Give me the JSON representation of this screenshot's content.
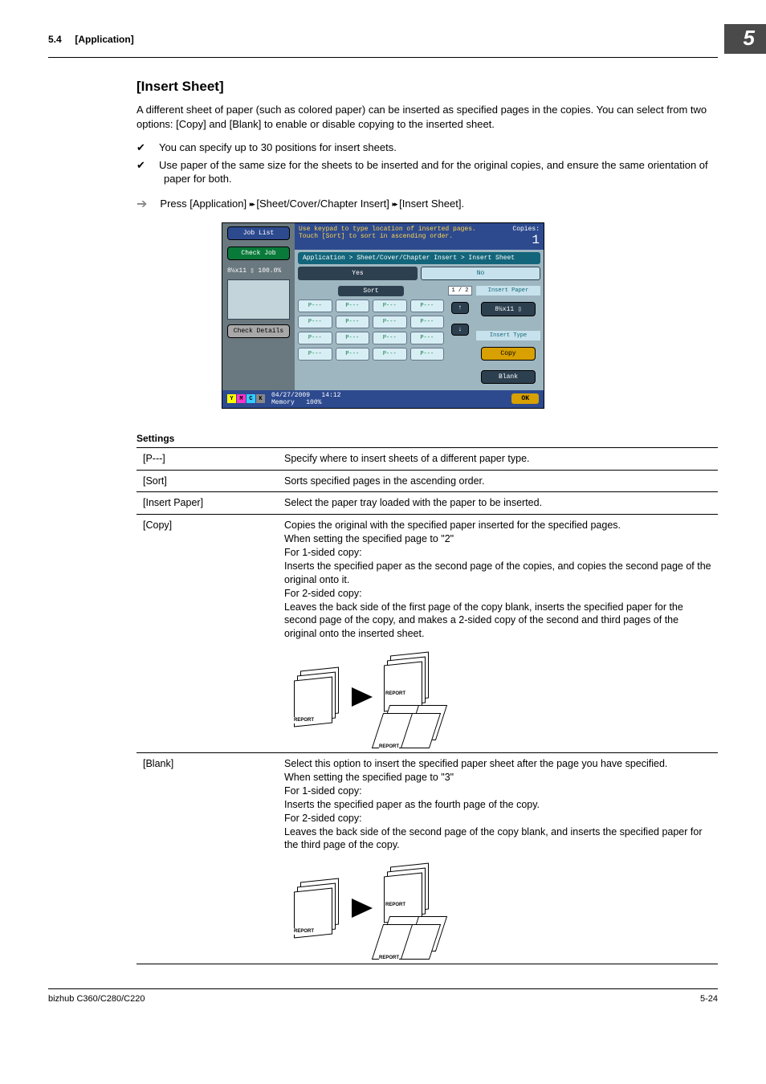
{
  "header": {
    "section_no": "5.4",
    "section_title": "[Application]",
    "chapter_no": "5"
  },
  "title": "[Insert Sheet]",
  "intro": "A different sheet of paper (such as colored paper) can be inserted as specified pages in the copies. You can select from two options: [Copy] and [Blank] to enable or disable copying to the inserted sheet.",
  "checks": [
    "You can specify up to 30 positions for insert sheets.",
    "Use paper of the same size for the sheets to be inserted and for the original copies, and ensure the same orientation of paper for both."
  ],
  "nav_line": {
    "prefix": "Press [Application] ",
    "sep": "▸▸",
    "mid": " [Sheet/Cover/Chapter Insert] ",
    "end": " [Insert Sheet]."
  },
  "screenshot": {
    "job_list": "Job List",
    "check_job": "Check Job",
    "paper_badge": "8½x11 ▯   100.0%",
    "check_details": "Check Details",
    "msg1": "Use keypad to type location of inserted pages.",
    "msg2": "Touch [Sort] to sort in ascending order.",
    "copies_label": "Copies:",
    "copies_value": "1",
    "breadcrumb": "Application > Sheet/Cover/Chapter Insert > Insert Sheet",
    "yes": "Yes",
    "no": "No",
    "sort": "Sort",
    "page_indicator": "1 / 2",
    "p_cell": "P---",
    "insert_paper": "Insert Paper",
    "paper_size": "8½x11 ▯",
    "insert_type": "Insert Type",
    "copy_btn": "Copy",
    "blank_btn": "Blank",
    "date": "04/27/2009",
    "time": "14:12",
    "memory": "Memory",
    "mem_val": "100%",
    "ok": "OK",
    "toner": {
      "y": "Y",
      "m": "M",
      "c": "C",
      "k": "K"
    }
  },
  "settings_heading": "Settings",
  "settings": {
    "row_p": {
      "label": "[P---]",
      "desc": "Specify where to insert sheets of a different paper type."
    },
    "row_sort": {
      "label": "[Sort]",
      "desc": "Sorts specified pages in the ascending order."
    },
    "row_insert": {
      "label": "[Insert Paper]",
      "desc": "Select the paper tray loaded with the paper to be inserted."
    },
    "row_copy": {
      "label": "[Copy]",
      "l1": "Copies the original with the specified paper inserted for the specified pages.",
      "l2": "When setting the specified page to \"2\"",
      "l3": "For 1-sided copy:",
      "l4": "Inserts the specified paper as the second page of the copies, and copies the second page of the original onto it.",
      "l5": "For 2-sided copy:",
      "l6": "Leaves the back side of the first page of the copy blank, inserts the specified paper for the second page of the copy, and makes a 2-sided copy of the second and third pages of the original onto the inserted sheet."
    },
    "row_blank": {
      "label": "[Blank]",
      "l1": "Select this option to insert the specified paper sheet after the page you have specified.",
      "l2": "When setting the specified page to \"3\"",
      "l3": "For 1-sided copy:",
      "l4": "Inserts the specified paper as the fourth page of the copy.",
      "l5": "For 2-sided copy:",
      "l6": "Leaves the back side of the second page of the copy blank, and inserts the specified paper for the third page of the copy."
    }
  },
  "diagram_label": "REPORT",
  "footer": {
    "left": "bizhub C360/C280/C220",
    "right": "5-24"
  }
}
